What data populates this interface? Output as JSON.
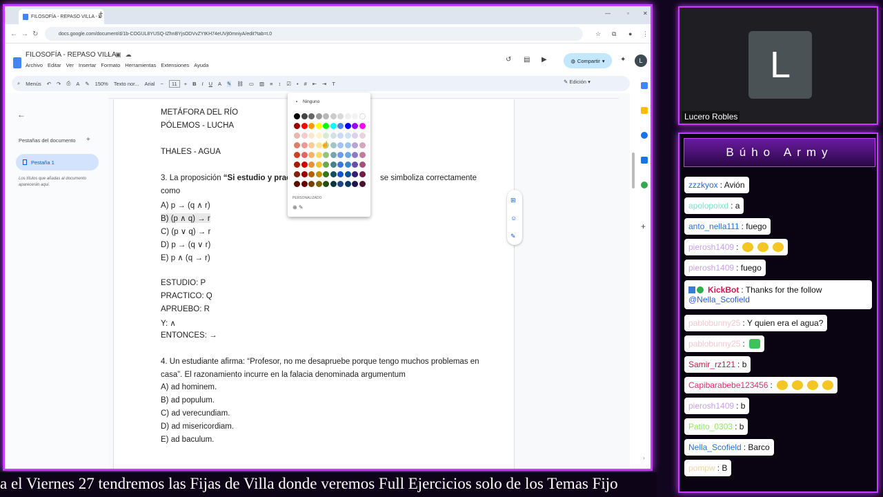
{
  "browser": {
    "tab_title": "FILOSOFÍA - REPASO VILLA - D",
    "tab_close": "×",
    "new_tab": "+",
    "url": "docs.google.com/document/d/1b-COGUL8YUSQ-IZhnBYjsODVvZYtKH74eUVjt0mniyA/edit?tab=t.0"
  },
  "doc": {
    "title": "FILOSOFÍA - REPASO VILLA",
    "menus": [
      "Archivo",
      "Editar",
      "Ver",
      "Insertar",
      "Formato",
      "Herramientas",
      "Extensiones",
      "Ayuda"
    ],
    "share_label": "Compartir",
    "avatar_letter": "L"
  },
  "toolbar": {
    "search": "Menús",
    "zoom": "150%",
    "style": "Texto nor...",
    "font": "Arial",
    "font_size": "11",
    "mode": "Edición"
  },
  "sidebar": {
    "title": "Pestañas del documento",
    "add": "+",
    "tab_label": "Pestaña 1",
    "hint": "Los títulos que añadas al documento aparecerán aquí."
  },
  "document_lines": [
    "METÁFORA DEL RÍO",
    "PÓLEMOS - LUCHA",
    "",
    "THALES - AGUA",
    "",
    "3. La proposición “Si estudio y practi",
    "como",
    "A) p → (q ∧ r)",
    "B) (p ∧ q) → r",
    "C) (p ∨ q) → r",
    "D) p → (q ∨ r)",
    "E) p ∧ (q → r)",
    "",
    "ESTUDIO: P",
    "PRACTICO: Q",
    "APRUEBO: R",
    "Y: ∧",
    "ENTONCES: →",
    "",
    "4. Un estudiante afirma: “Profesor, no me desapruebe porque tengo muchos problemas en",
    "casa”. El razonamiento incurre en la falacia denominada argumentum",
    "A) ad hominem.",
    "B) ad populum.",
    "C) ad verecundiam.",
    "D) ad misericordiam.",
    "E) ad baculum."
  ],
  "line3_tail": "se simboliza correctamente",
  "palette": {
    "none_label": "Ninguno",
    "custom_label": "PERSONALIZADO",
    "rows": [
      [
        "#000000",
        "#434343",
        "#666666",
        "#999999",
        "#b7b7b7",
        "#cccccc",
        "#d9d9d9",
        "#efefef",
        "#f3f3f3",
        "#ffffff"
      ],
      [
        "#980000",
        "#ff0000",
        "#ff9900",
        "#ffff00",
        "#00ff00",
        "#00ffff",
        "#4a86e8",
        "#0000ff",
        "#9900ff",
        "#ff00ff"
      ],
      [
        "#e6b8af",
        "#f4cccc",
        "#fce5cd",
        "#fff2cc",
        "#d9ead3",
        "#d0e0e3",
        "#c9daf8",
        "#cfe2f3",
        "#d9d2e9",
        "#ead1dc"
      ],
      [
        "#dd7e6b",
        "#ea9999",
        "#f9cb9c",
        "#ffe599",
        "#b6d7a8",
        "#a2c4c9",
        "#a4c2f4",
        "#9fc5e8",
        "#b4a7d6",
        "#d5a6bd"
      ],
      [
        "#cc4125",
        "#e06666",
        "#f6b26b",
        "#ffd966",
        "#93c47d",
        "#76a5af",
        "#6d9eeb",
        "#6fa8dc",
        "#8e7cc3",
        "#c27ba0"
      ],
      [
        "#a61c00",
        "#cc0000",
        "#e69138",
        "#f1c232",
        "#6aa84f",
        "#45818e",
        "#3c78d8",
        "#3d85c6",
        "#674ea7",
        "#a64d79"
      ],
      [
        "#85200c",
        "#990000",
        "#b45f06",
        "#bf9000",
        "#38761d",
        "#134f5c",
        "#1155cc",
        "#0b5394",
        "#351c75",
        "#741b47"
      ],
      [
        "#5b0f00",
        "#660000",
        "#783f04",
        "#7f6000",
        "#274e13",
        "#0c343d",
        "#1c4587",
        "#073763",
        "#20124d",
        "#4c1130"
      ]
    ]
  },
  "ticker": "a el Viernes 27 tendremos las Fijas de Villa donde veremos Full Ejercicios solo de los Temas Fijo",
  "camera": {
    "initial": "L",
    "name": "Lucero Robles"
  },
  "chat": {
    "title": "Búho Army",
    "messages": [
      {
        "user": "zzzkyox",
        "color": "#1e6fd9",
        "text": ": Avión"
      },
      {
        "user": "apolopoixd",
        "color": "#7fe0c8",
        "text": ": a"
      },
      {
        "user": "anto_nella111",
        "color": "#2a6fd1",
        "text": ": fuego"
      },
      {
        "user": "pierosh1409",
        "color": "#c8a0e8",
        "text": ":",
        "emotes": 3
      },
      {
        "user": "pierosh1409",
        "color": "#c8a0e8",
        "text": ": fuego"
      },
      {
        "user": "KickBot",
        "color": "#d01850",
        "text": ": Thanks for the follow",
        "text2": "@Nella_Scofield"
      },
      {
        "user": "pablobunny25",
        "color": "#f0c8d0",
        "text": ": Y quien era el agua?"
      },
      {
        "user": "pablobunny25",
        "color": "#f0c8d0",
        "text": ":",
        "emotes": 1,
        "green": true
      },
      {
        "user": "Samir_rz121",
        "color": "#c0184a",
        "text": ": b"
      },
      {
        "user": "Capibarabebe123456",
        "color": "#d8306a",
        "text": ":",
        "emotes": 4
      },
      {
        "user": "pierosh1409",
        "color": "#c8a0e8",
        "text": ": b"
      },
      {
        "user": "Patito_0303",
        "color": "#8ee860",
        "text": ": b"
      },
      {
        "user": "Nella_Scofield",
        "color": "#2a6fd1",
        "text": ": Barco"
      },
      {
        "user": "pompw",
        "color": "#f0d8a0",
        "text": ": B"
      }
    ]
  }
}
